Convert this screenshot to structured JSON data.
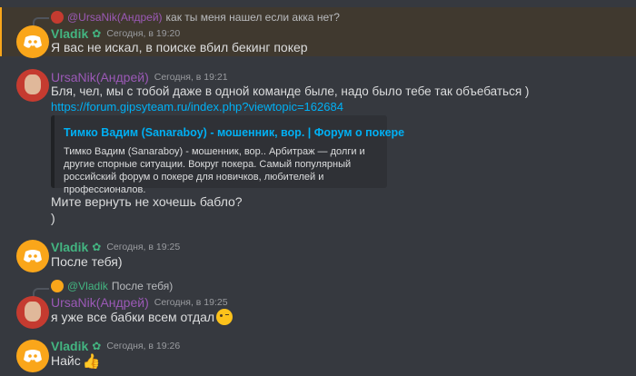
{
  "msg1": {
    "reply": {
      "author": "@UrsaNik(Андрей)",
      "text": "как ты меня нашел если акка нет?"
    },
    "author": "Vladik",
    "timestamp": "Сегодня, в 19:20",
    "text": "Я вас не искал, в поиске вбил бекинг покер"
  },
  "msg2": {
    "author": "UrsaNik(Андрей)",
    "timestamp": "Сегодня, в 19:21",
    "text": "Бля, чел, мы с тобой даже в одной команде быле, надо было тебе так объебаться )",
    "link": "https://forum.gipsyteam.ru/index.php?viewtopic=162684",
    "embed": {
      "title": "Тимко Вадим (Sanaraboy) - мошенник, вор. | Форум о покере",
      "description": "Тимко Вадим (Sanaraboy) - мошенник, вор.. Арбитраж — долги и другие спорные ситуации. Вокруг покера. Самый популярный российский форум о покере для новичков, любителей и профессионалов."
    },
    "text2": "Мите вернуть не хочешь бабло?",
    "text3": ")"
  },
  "msg3": {
    "author": "Vladik",
    "timestamp": "Сегодня, в 19:25",
    "text": "После тебя)"
  },
  "msg4": {
    "reply": {
      "author": "@Vladik",
      "text": "После тебя)"
    },
    "author": "UrsaNik(Андрей)",
    "timestamp": "Сегодня, в 19:25",
    "text": "я уже все бабки всем отдал"
  },
  "msg5": {
    "author": "Vladik",
    "timestamp": "Сегодня, в 19:26",
    "text": "Найс"
  },
  "icons": {
    "discord": "discord-logo-icon",
    "sprout": "sprout-icon",
    "wink": "wink-emoji-icon",
    "thumbs_up": "thumbs-up-emoji-icon"
  },
  "colors": {
    "background": "#36393f",
    "vladik_name": "#43b581",
    "ursa_name": "#9b59b6",
    "link": "#00b0f4",
    "highlight": "#40392f",
    "highlight_border": "#faa61a"
  }
}
